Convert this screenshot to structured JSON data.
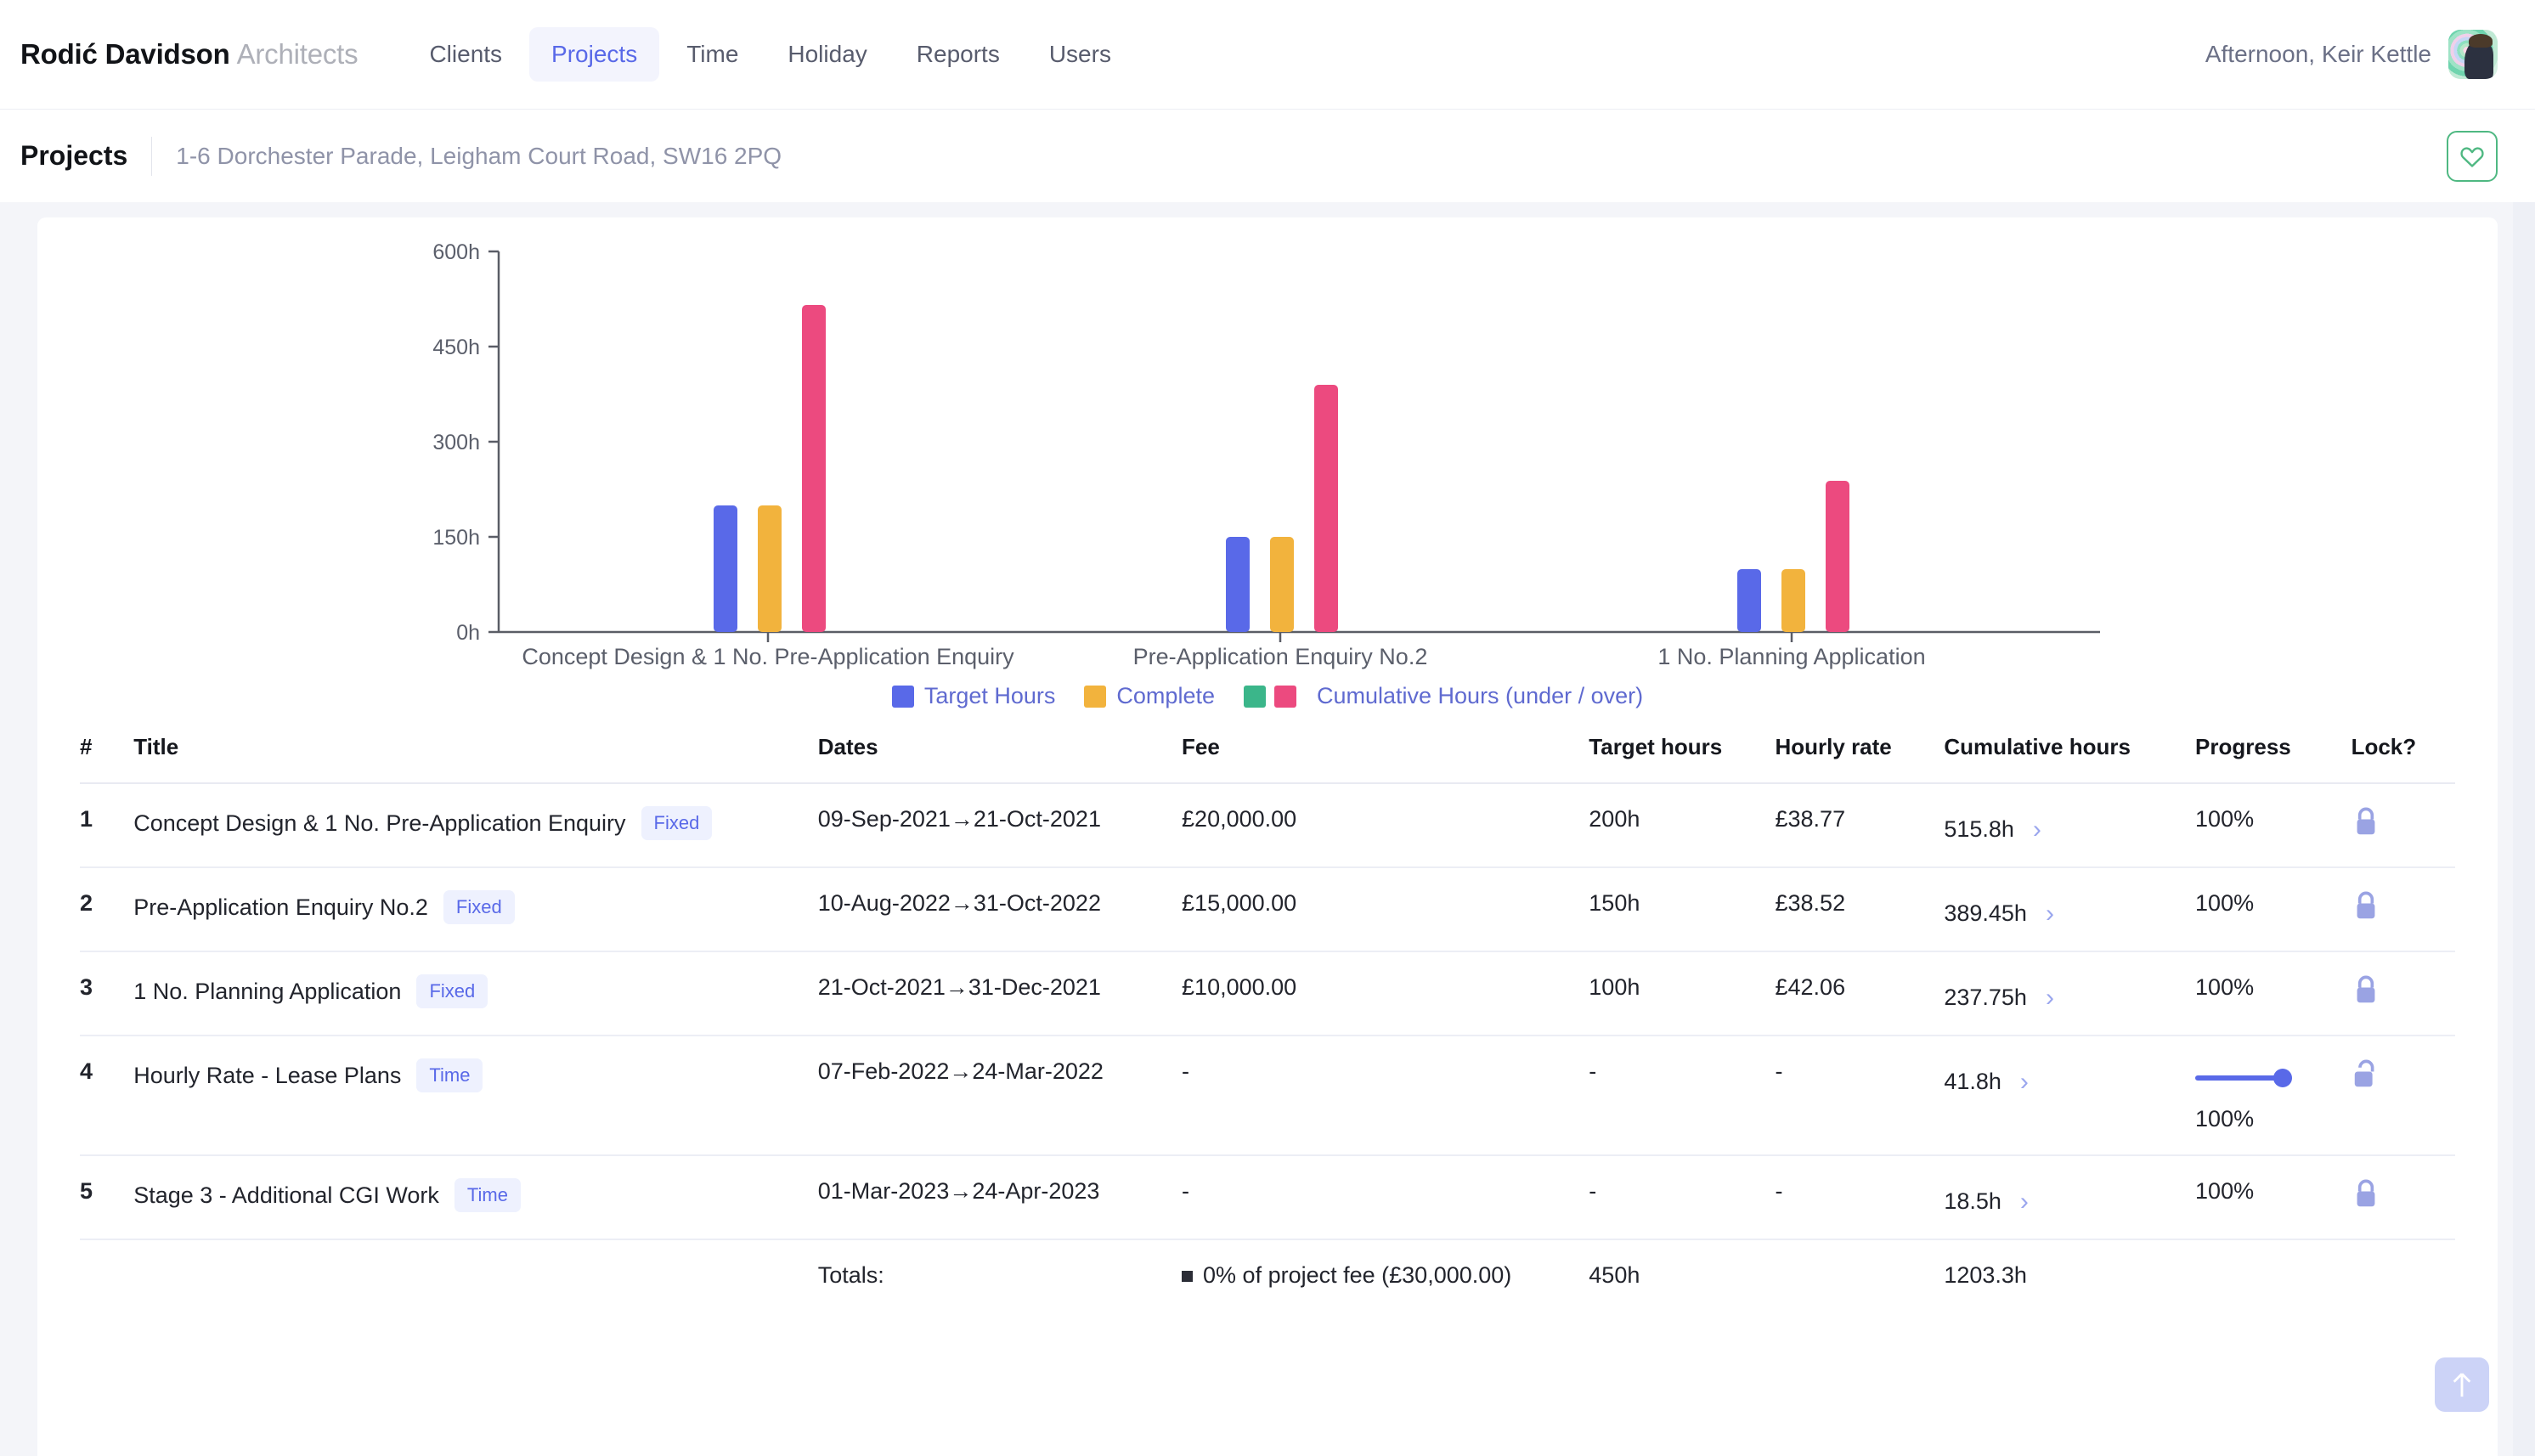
{
  "header": {
    "brand_strong": "Rodić Davidson",
    "brand_light": "Architects",
    "nav": [
      {
        "label": "Clients",
        "active": false
      },
      {
        "label": "Projects",
        "active": true
      },
      {
        "label": "Time",
        "active": false
      },
      {
        "label": "Holiday",
        "active": false
      },
      {
        "label": "Reports",
        "active": false
      },
      {
        "label": "Users",
        "active": false
      }
    ],
    "greeting": "Afternoon, Keir Kettle"
  },
  "breadcrumb": {
    "title": "Projects",
    "subtitle": "1-6 Dorchester Parade, Leigham Court Road, SW16 2PQ",
    "favourite_icon": "heart-icon"
  },
  "chart_data": {
    "type": "bar",
    "title": "",
    "xlabel": "",
    "ylabel": "",
    "ylim": [
      0,
      600
    ],
    "yticks": [
      "0h",
      "150h",
      "300h",
      "450h",
      "600h"
    ],
    "grid": false,
    "legend_position": "bottom",
    "categories": [
      "Concept Design & 1 No. Pre-Application Enquiry",
      "Pre-Application Enquiry No.2",
      "1 No. Planning Application"
    ],
    "series": [
      {
        "name": "Target Hours",
        "color": "#5969e8",
        "values": [
          200,
          150,
          100
        ]
      },
      {
        "name": "Complete",
        "color": "#f2b33d",
        "values": [
          200,
          150,
          100
        ]
      },
      {
        "name": "Cumulative Hours (under / over)",
        "color": "#ec4a7f",
        "values": [
          515.8,
          389.45,
          237.75
        ]
      }
    ],
    "legend": [
      {
        "label": "Target Hours",
        "colors": [
          "#5969e8"
        ]
      },
      {
        "label": "Complete",
        "colors": [
          "#f2b33d"
        ]
      },
      {
        "label": "Cumulative Hours (under / over)",
        "colors": [
          "#3bb68a",
          "#ec4a7f"
        ]
      }
    ]
  },
  "table": {
    "columns": [
      "#",
      "Title",
      "Dates",
      "Fee",
      "Target hours",
      "Hourly rate",
      "Cumulative hours",
      "Progress",
      "Lock?"
    ],
    "rows": [
      {
        "num": "1",
        "title": "Concept Design & 1 No. Pre-Application Enquiry",
        "badge": "Fixed",
        "dates": "09-Sep-2021→21-Oct-2021",
        "fee": "£20,000.00",
        "target": "200h",
        "rate": "£38.77",
        "cumulative": "515.8h",
        "progress": "100%",
        "lock": "locked",
        "slider": false
      },
      {
        "num": "2",
        "title": "Pre-Application Enquiry No.2",
        "badge": "Fixed",
        "dates": "10-Aug-2022→31-Oct-2022",
        "fee": "£15,000.00",
        "target": "150h",
        "rate": "£38.52",
        "cumulative": "389.45h",
        "progress": "100%",
        "lock": "locked",
        "slider": false
      },
      {
        "num": "3",
        "title": "1 No. Planning Application",
        "badge": "Fixed",
        "dates": "21-Oct-2021→31-Dec-2021",
        "fee": "£10,000.00",
        "target": "100h",
        "rate": "£42.06",
        "cumulative": "237.75h",
        "progress": "100%",
        "lock": "locked",
        "slider": false
      },
      {
        "num": "4",
        "title": "Hourly Rate - Lease Plans",
        "badge": "Time",
        "dates": "07-Feb-2022→24-Mar-2022",
        "fee": "-",
        "target": "-",
        "rate": "-",
        "cumulative": "41.8h",
        "progress": "100%",
        "lock": "unlocked",
        "slider": true
      },
      {
        "num": "5",
        "title": "Stage 3 - Additional CGI Work",
        "badge": "Time",
        "dates": "01-Mar-2023→24-Apr-2023",
        "fee": "-",
        "target": "-",
        "rate": "-",
        "cumulative": "18.5h",
        "progress": "100%",
        "lock": "locked",
        "slider": false
      }
    ],
    "totals": {
      "label": "Totals:",
      "fee": "0% of project fee (£30,000.00)",
      "target": "450h",
      "cumulative": "1203.3h"
    }
  },
  "scroll_top_icon": "arrow-up-icon"
}
